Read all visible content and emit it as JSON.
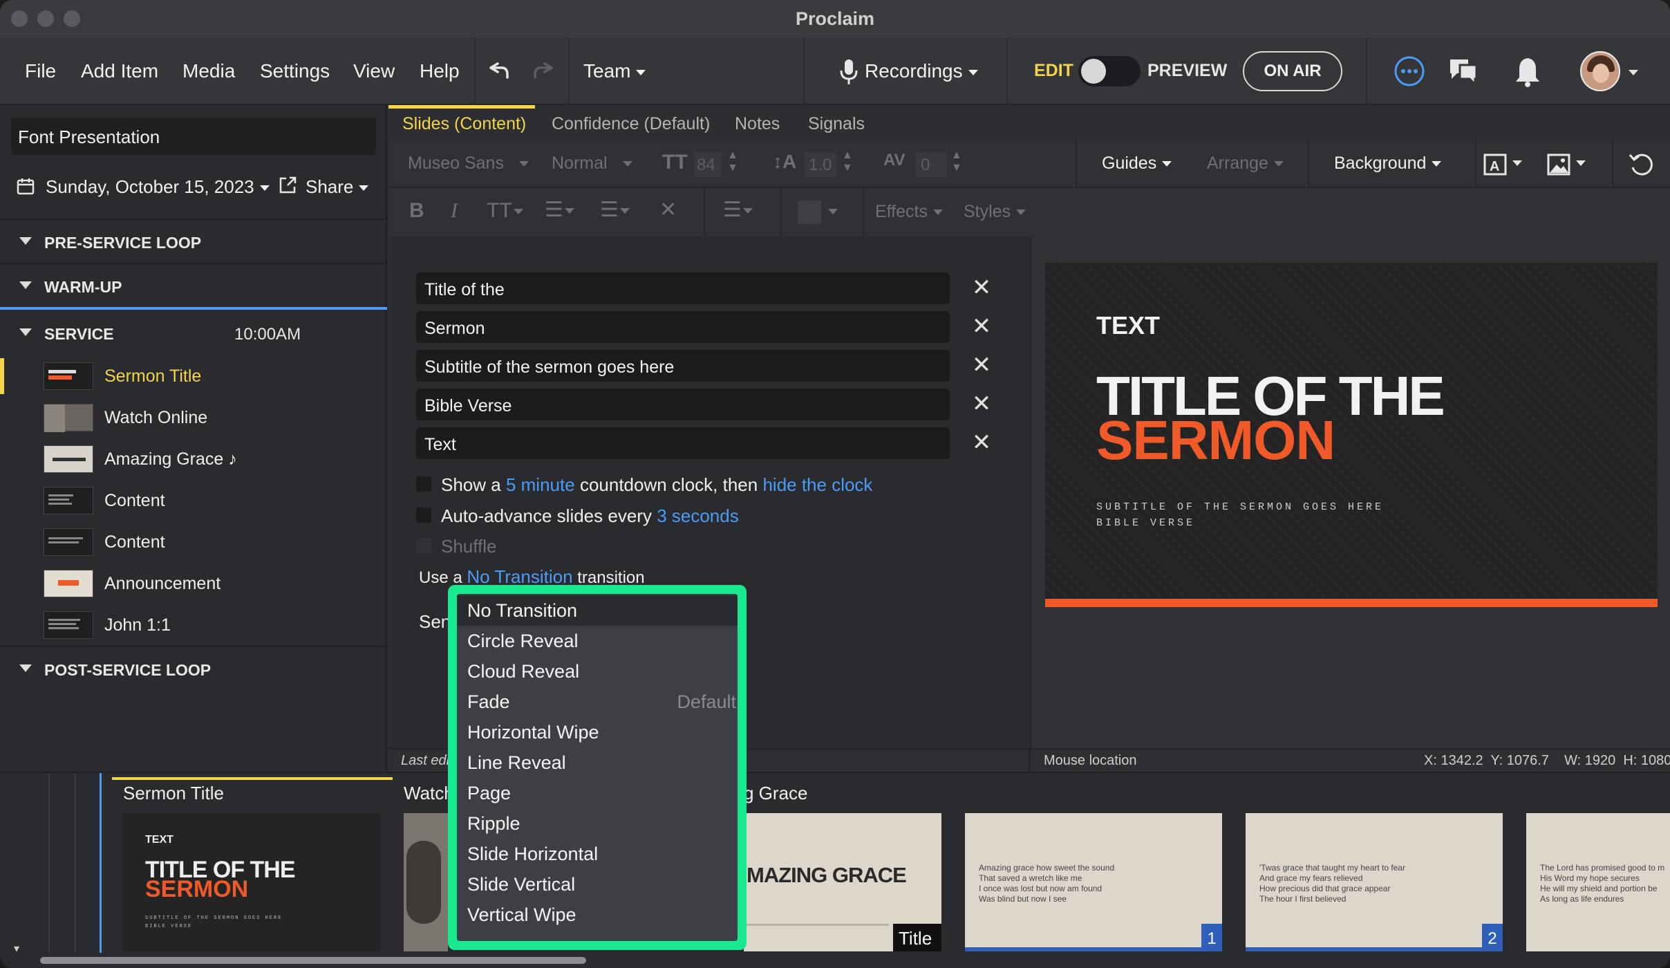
{
  "app": {
    "title": "Proclaim"
  },
  "menubar": {
    "file": "File",
    "add_item": "Add Item",
    "media": "Media",
    "settings": "Settings",
    "view": "View",
    "help": "Help",
    "team": "Team",
    "recordings": "Recordings",
    "edit": "EDIT",
    "preview": "PREVIEW",
    "on_air": "ON AIR"
  },
  "sidebar": {
    "presentation_name": "Font Presentation",
    "date": "Sunday, October 15, 2023",
    "share": "Share",
    "sections": {
      "pre": "PRE-SERVICE LOOP",
      "warm": "WARM-UP",
      "service": "SERVICE",
      "service_time": "10:00AM",
      "post": "POST-SERVICE LOOP"
    },
    "items": [
      {
        "label": "Sermon Title"
      },
      {
        "label": "Watch Online"
      },
      {
        "label": "Amazing Grace ♪"
      },
      {
        "label": "Content"
      },
      {
        "label": "Content"
      },
      {
        "label": "Announcement"
      },
      {
        "label": "John 1:1"
      }
    ]
  },
  "tabs": [
    "Slides (Content)",
    "Confidence (Default)",
    "Notes",
    "Signals"
  ],
  "toolbar": {
    "font": "Museo Sans",
    "weight": "Normal",
    "size": "84",
    "line": "1.0",
    "spacing": "0",
    "guides": "Guides",
    "arrange": "Arrange",
    "background": "Background",
    "effects": "Effects",
    "styles": "Styles"
  },
  "fields": [
    "Title of the",
    "Sermon",
    "Subtitle of the sermon goes here",
    "Bible Verse",
    "Text"
  ],
  "options": {
    "countdown": {
      "pre": "Show a",
      "minutes": "5 minute",
      "mid": "countdown clock, then",
      "hide": "hide the clock"
    },
    "auto": {
      "pre": "Auto-advance slides every",
      "secs": "3 seconds"
    },
    "shuffle": "Shuffle",
    "transition": {
      "pre": "Use a",
      "value": "No Transition",
      "post": "transition"
    },
    "partial": "Sen"
  },
  "preview": {
    "text": "TEXT",
    "title1": "TITLE OF THE",
    "title2": "SERMON",
    "subtitle": "SUBTITLE OF THE SERMON GOES HERE",
    "verse": "BIBLE VERSE",
    "accent": "#f05a28"
  },
  "statusbar": {
    "last_edit": "Last edi",
    "mouse": "Mouse location",
    "coords": "X: 1342.2  Y: 1076.7    W: 1920  H: 1080"
  },
  "strip": {
    "groups": [
      "Sermon Title",
      "Watch",
      "g Grace"
    ],
    "card1": {
      "text": "TEXT",
      "t1": "TITLE OF THE",
      "t2": "SERMON",
      "sub": "SUBTITLE OF THE SERMON GOES HERE",
      "verse": "BIBLE VERSE"
    },
    "amazing": "MAZING GRACE",
    "amazing_badge": "Title",
    "lyric1": [
      "Amazing grace how sweet the sound",
      "That saved a wretch like me",
      "I once was lost but now am found",
      "Was blind but now I see"
    ],
    "lyric2": [
      "'Twas grace that taught my heart to fear",
      "And grace my fears relieved",
      "How precious did that grace appear",
      "The hour I first believed"
    ],
    "lyric3": [
      "The Lord has promised good to m",
      "His Word my hope secures",
      "He will my shield and portion be",
      "As long as life endures"
    ],
    "badge1": "1",
    "badge2": "2"
  },
  "transition_menu": {
    "items": [
      "No Transition",
      "Circle Reveal",
      "Cloud Reveal",
      "Fade",
      "Horizontal Wipe",
      "Line Reveal",
      "Page",
      "Ripple",
      "Slide Horizontal",
      "Slide Vertical",
      "Vertical Wipe"
    ],
    "default_label": "Default"
  }
}
